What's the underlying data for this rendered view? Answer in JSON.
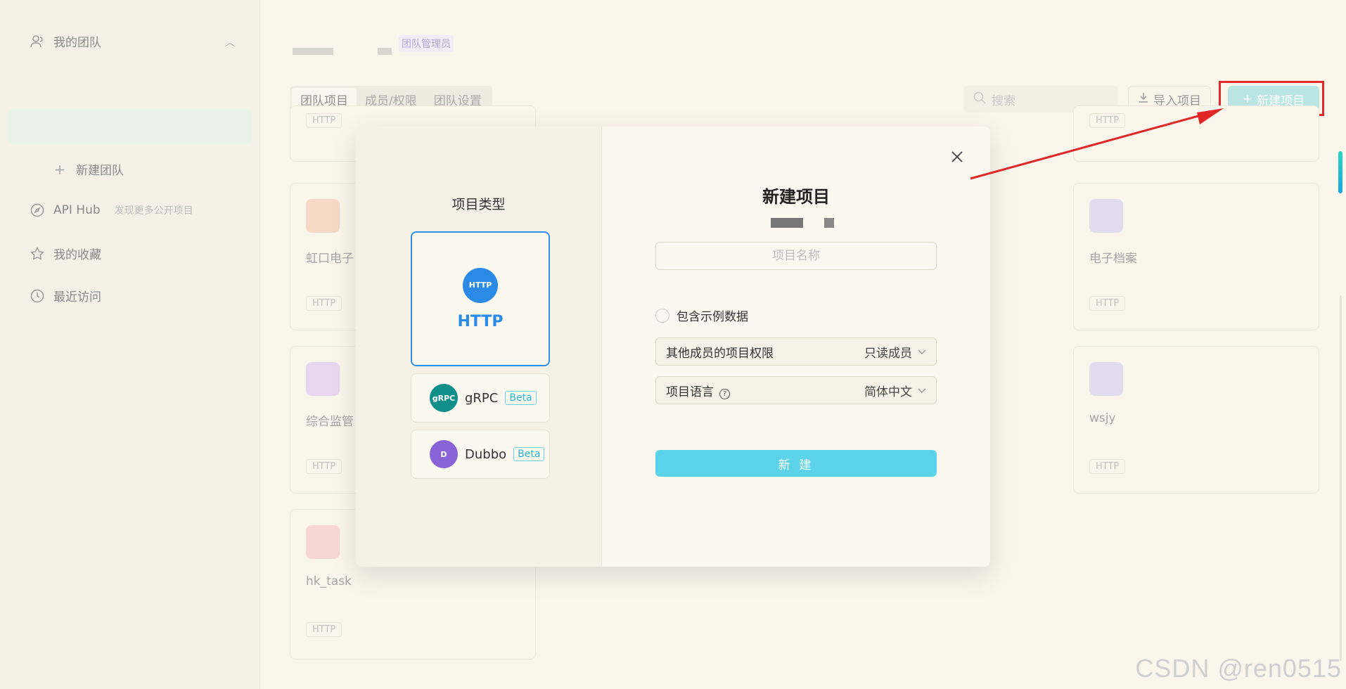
{
  "sidebar": {
    "my_team": "我的团队",
    "new_team": "新建团队",
    "api_hub": "API Hub",
    "api_hub_sub": "发现更多公开项目",
    "favorites": "我的收藏",
    "recent": "最近访问"
  },
  "header": {
    "role_badge": "团队管理员",
    "tabs": [
      "团队项目",
      "成员/权限",
      "团队设置"
    ],
    "search_placeholder": "搜索",
    "import_label": "导入项目",
    "new_label": "新建项目"
  },
  "cards": [
    {
      "title": "",
      "tag": "HTTP"
    },
    {
      "title": "虹口电子",
      "tag": "HTTP"
    },
    {
      "title": "综合监管",
      "tag": "HTTP"
    },
    {
      "title": "hk_task",
      "tag": "HTTP"
    },
    {
      "title": "",
      "tag": "HTTP"
    },
    {
      "title": "电子档案",
      "tag": "HTTP"
    },
    {
      "title": "wsjy",
      "tag": "HTTP"
    }
  ],
  "modal": {
    "type_title": "项目类型",
    "types": [
      {
        "label": "HTTP",
        "icon_text": "HTTP",
        "selected": true
      },
      {
        "label": "gRPC",
        "icon_text": "gRPC",
        "badge": "Beta"
      },
      {
        "label": "Dubbo",
        "icon_text": "D",
        "badge": "Beta"
      }
    ],
    "form_title": "新建项目",
    "name_placeholder": "项目名称",
    "sample_data_label": "包含示例数据",
    "permission_label": "其他成员的项目权限",
    "permission_value": "只读成员",
    "language_label": "项目语言",
    "language_value": "简体中文",
    "submit_label": "新 建"
  },
  "colors": {
    "accent_blue": "#2a8ae6",
    "submit_cyan": "#5cd3e8",
    "highlight_red": "#e12727",
    "grpc_teal": "#0f8f8a",
    "dubbo_purple": "#8a63d8"
  },
  "watermark": "CSDN @ren0515"
}
